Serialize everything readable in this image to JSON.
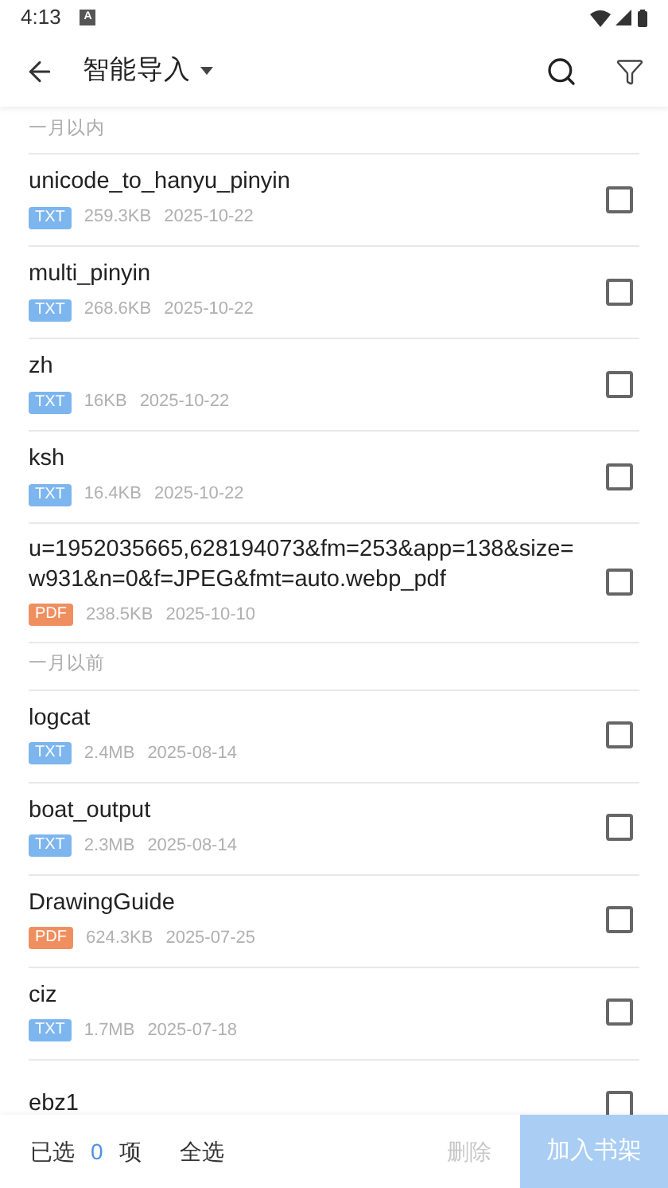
{
  "status_bar": {
    "time": "4:13",
    "notification": "A"
  },
  "toolbar": {
    "title": "智能导入"
  },
  "sections": [
    {
      "header": "一月以内",
      "files": [
        {
          "name": "unicode_to_hanyu_pinyin",
          "tag": "TXT",
          "color": "#7db5ee",
          "size": "259.3KB",
          "date": "2025-10-22",
          "checked": false
        },
        {
          "name": "multi_pinyin",
          "tag": "TXT",
          "color": "#7db5ee",
          "size": "268.6KB",
          "date": "2025-10-22",
          "checked": false
        },
        {
          "name": "zh",
          "tag": "TXT",
          "color": "#7db5ee",
          "size": "16KB",
          "date": "2025-10-22",
          "checked": false
        },
        {
          "name": "ksh",
          "tag": "TXT",
          "color": "#7db5ee",
          "size": "16.4KB",
          "date": "2025-10-22",
          "checked": false
        },
        {
          "name": "u=1952035665,628194073&fm=253&app=138&size=w931&n=0&f=JPEG&fmt=auto.webp_pdf",
          "tag": "PDF",
          "color": "#ef8f5f",
          "size": "238.5KB",
          "date": "2025-10-10",
          "checked": false
        }
      ]
    },
    {
      "header": "一月以前",
      "files": [
        {
          "name": "logcat",
          "tag": "TXT",
          "color": "#7db5ee",
          "size": "2.4MB",
          "date": "2025-08-14",
          "checked": false
        },
        {
          "name": "boat_output",
          "tag": "TXT",
          "color": "#7db5ee",
          "size": "2.3MB",
          "date": "2025-08-14",
          "checked": false
        },
        {
          "name": "DrawingGuide",
          "tag": "PDF",
          "color": "#ef8f5f",
          "size": "624.3KB",
          "date": "2025-07-25",
          "checked": false
        },
        {
          "name": "ciz",
          "tag": "TXT",
          "color": "#7db5ee",
          "size": "1.7MB",
          "date": "2025-07-18",
          "checked": false
        },
        {
          "name": "ebz1",
          "checked": false
        }
      ]
    }
  ],
  "bottom_bar": {
    "selected_label": "已选",
    "selected_count": "0",
    "selected_unit": "项",
    "select_all": "全选",
    "delete": {
      "label": "删除",
      "disabled": true
    },
    "add": {
      "label": "加入书架",
      "disabled": true
    }
  }
}
